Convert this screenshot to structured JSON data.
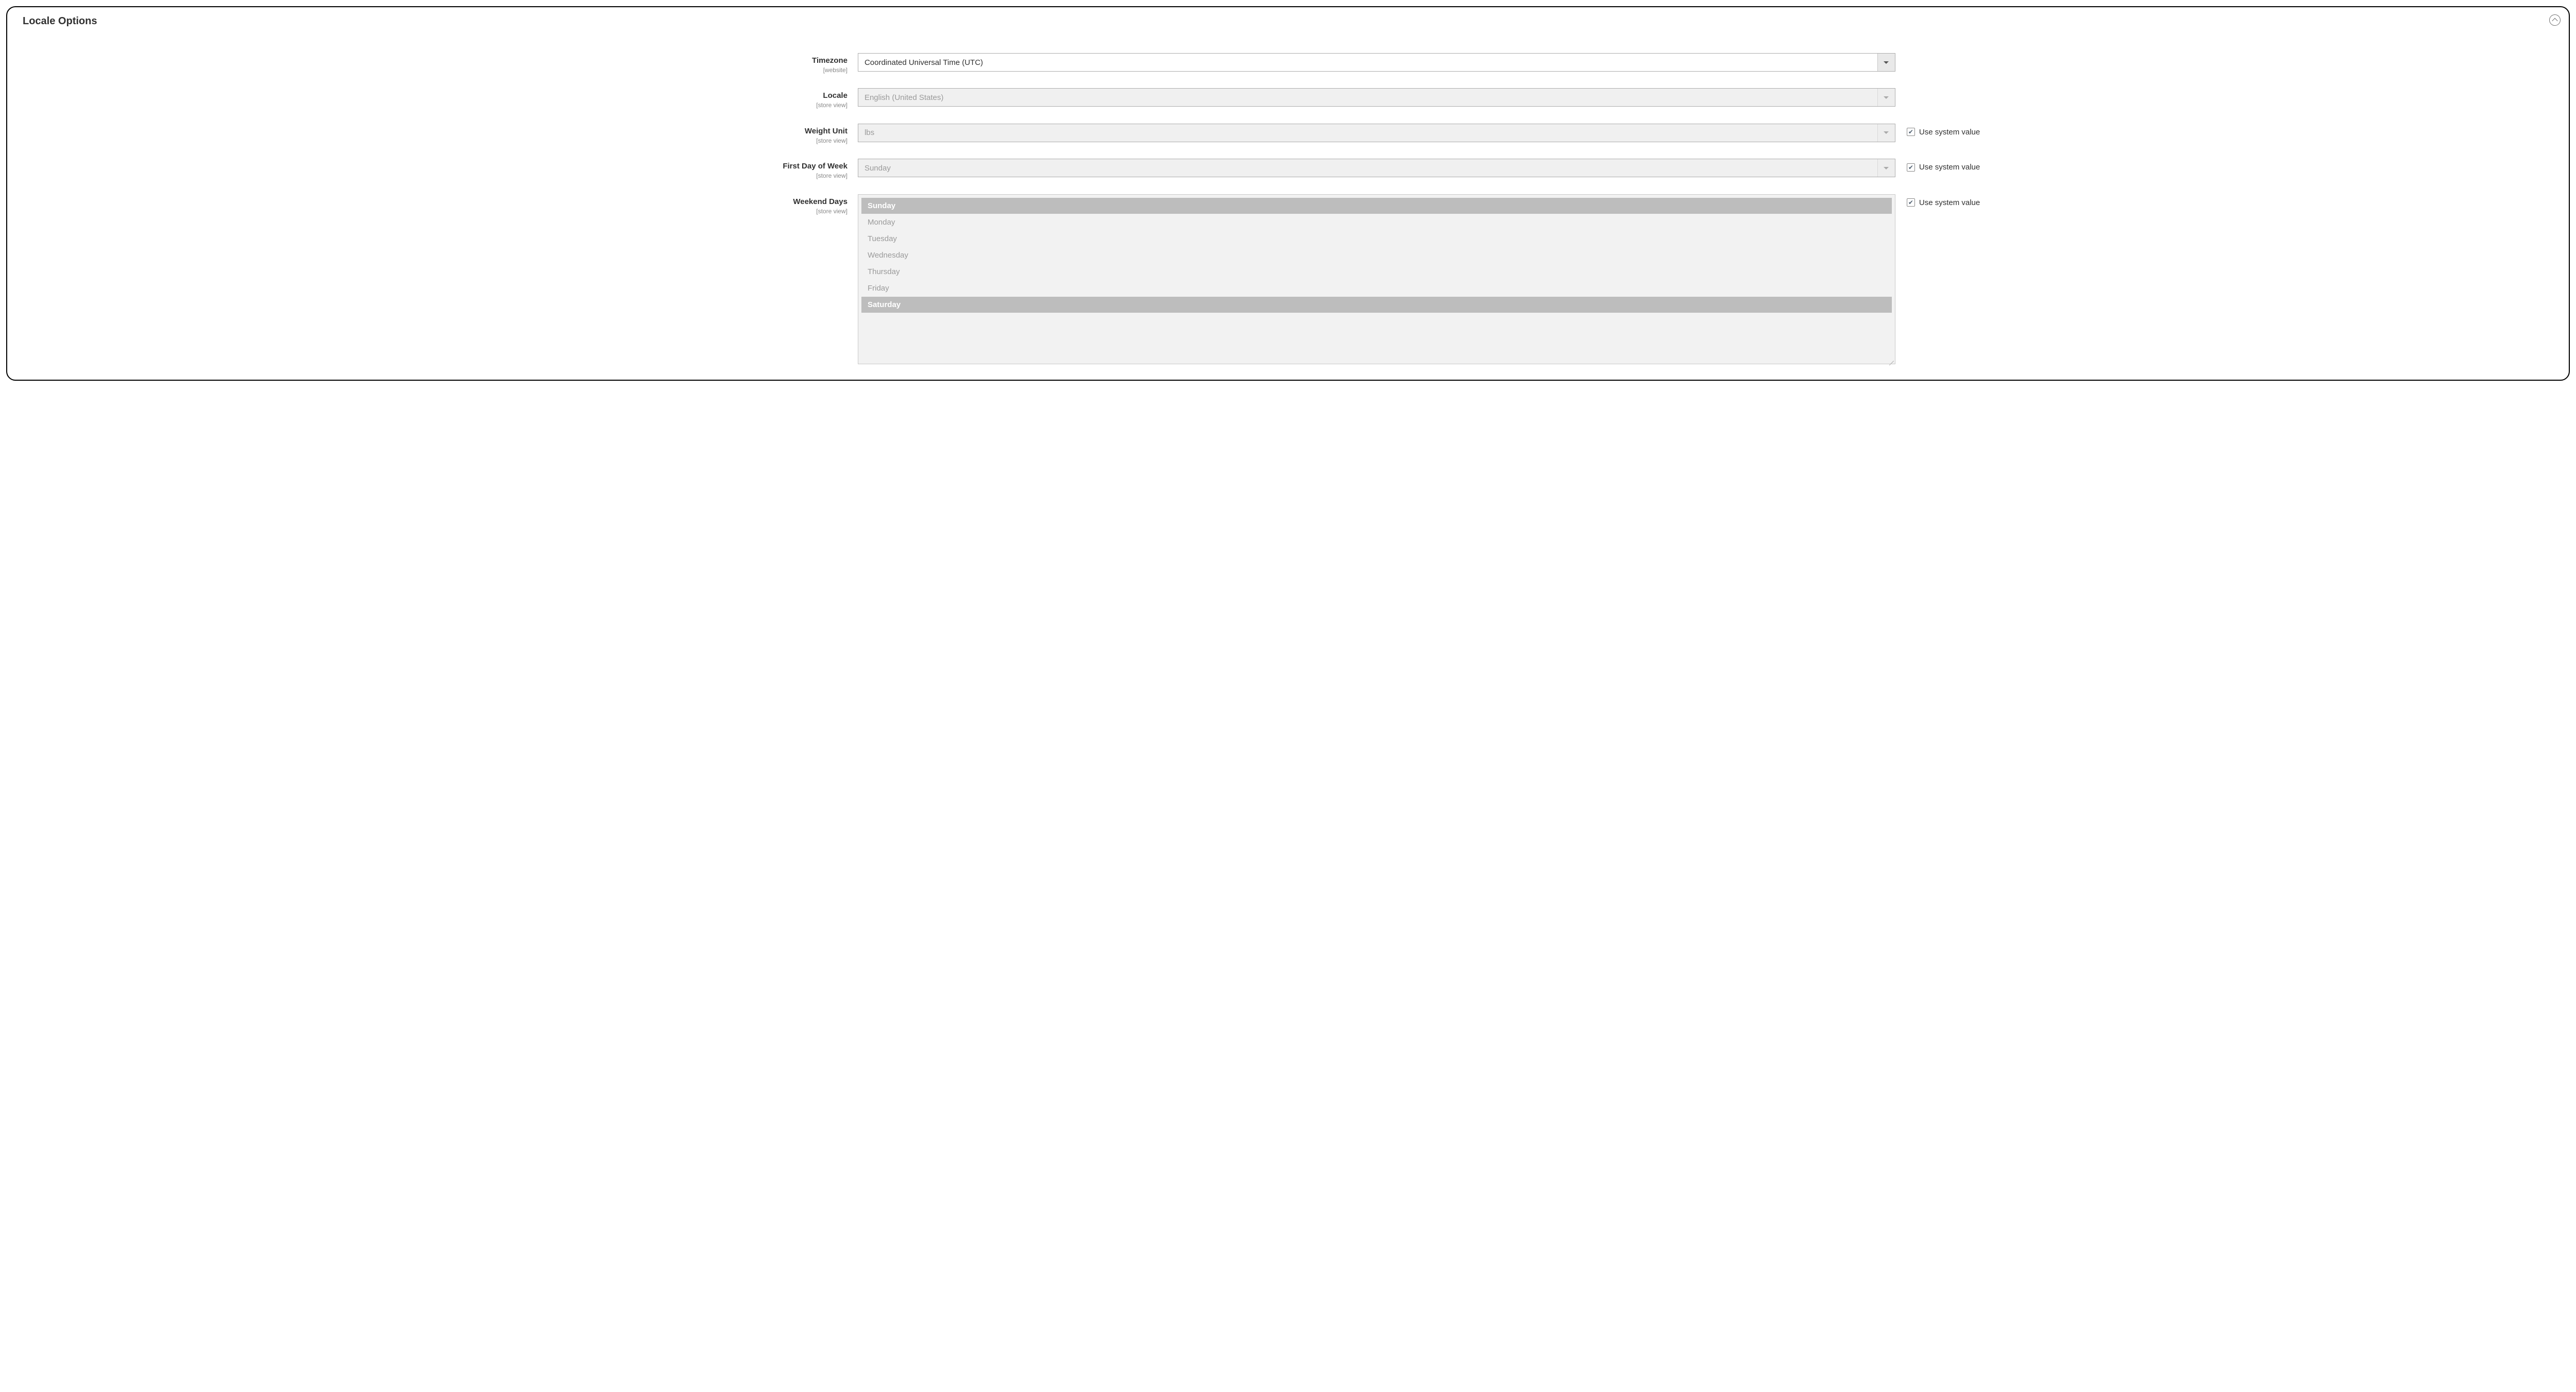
{
  "panel": {
    "title": "Locale Options"
  },
  "fields": {
    "timezone": {
      "label": "Timezone",
      "scope": "[website]",
      "value": "Coordinated Universal Time (UTC)"
    },
    "locale": {
      "label": "Locale",
      "scope": "[store view]",
      "value": "English (United States)"
    },
    "weight_unit": {
      "label": "Weight Unit",
      "scope": "[store view]",
      "value": "lbs",
      "use_system_label": "Use system value"
    },
    "first_day": {
      "label": "First Day of Week",
      "scope": "[store view]",
      "value": "Sunday",
      "use_system_label": "Use system value"
    },
    "weekend_days": {
      "label": "Weekend Days",
      "scope": "[store view]",
      "use_system_label": "Use system value",
      "options": {
        "sunday": "Sunday",
        "monday": "Monday",
        "tuesday": "Tuesday",
        "wednesday": "Wednesday",
        "thursday": "Thursday",
        "friday": "Friday",
        "saturday": "Saturday"
      }
    }
  }
}
